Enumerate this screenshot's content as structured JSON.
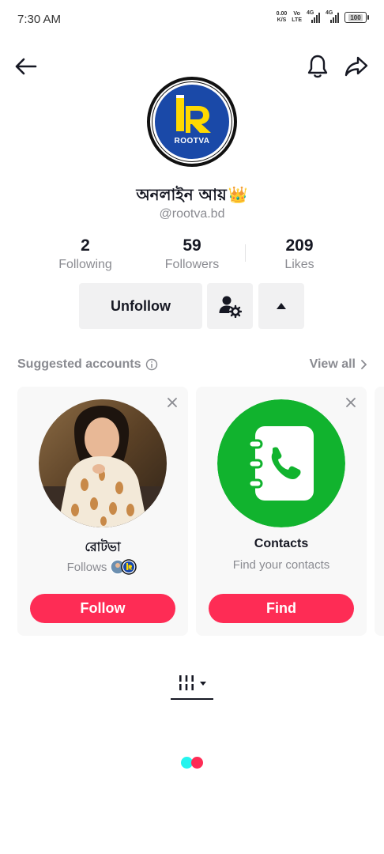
{
  "status_bar": {
    "time": "7:30 AM",
    "net_speed": "0.00",
    "net_unit": "K/S",
    "volte_top": "Vo",
    "volte_bottom": "LTE",
    "sig1_label": "4G",
    "sig2_label": "4G",
    "battery": "100"
  },
  "nav": {
    "back_icon": "arrow-left-icon",
    "bell_icon": "bell-icon",
    "share_icon": "share-icon"
  },
  "profile": {
    "avatar_logo_text": "ROOTVA",
    "display_name": "অনলাইন আয়",
    "crown": "👑",
    "username": "@rootva.bd"
  },
  "stats": [
    {
      "value": "2",
      "label": "Following"
    },
    {
      "value": "59",
      "label": "Followers"
    },
    {
      "value": "209",
      "label": "Likes"
    }
  ],
  "actions": {
    "unfollow_label": "Unfollow",
    "manage_icon": "person-gear-icon",
    "collapse_icon": "triangle-up-icon"
  },
  "suggested": {
    "title": "Suggested accounts",
    "view_all": "View all",
    "cards": [
      {
        "name": "রোটভা",
        "sub": "Follows",
        "button": "Follow"
      },
      {
        "name": "Contacts",
        "sub": "Find your contacts",
        "button": "Find"
      }
    ]
  },
  "colors": {
    "primary_red": "#fe2c55",
    "contacts_green": "#11b32e",
    "logo_blue": "#1a49a8",
    "logo_yellow": "#ffd900",
    "loader_cyan": "#25f4ee"
  }
}
